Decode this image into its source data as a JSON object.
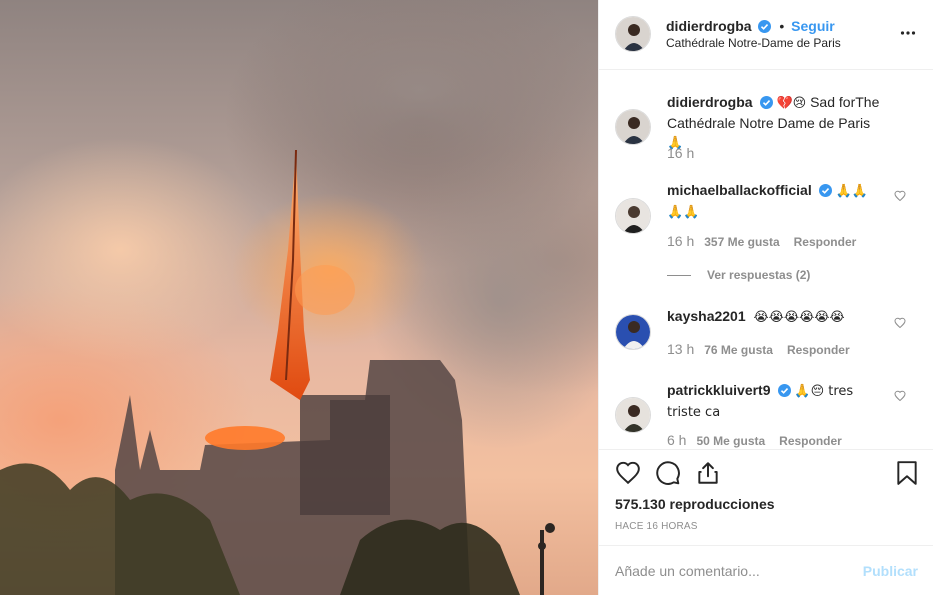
{
  "post": {
    "author": "didierdrogba",
    "follow_label": "Seguir",
    "location": "Cathédrale Notre-Dame de Paris",
    "caption_suffix": "Sad forThe Cathédrale Notre Dame de Paris",
    "caption_emoji": "💔😢",
    "caption_end_emoji": "🙏",
    "caption_time": "16 h",
    "views": "575.130 reproducciones",
    "posted_ago": "HACE 16 HORAS"
  },
  "comments": [
    {
      "user": "michaelballackofficial",
      "text": "🙏🙏 🙏🙏",
      "time": "16 h",
      "likes": "357 Me gusta",
      "reply": "Responder",
      "view_replies": "Ver respuestas (2)",
      "verified": true
    },
    {
      "user": "kaysha2201",
      "text": "😭😭😭😭😭😭",
      "time": "13 h",
      "likes": "76 Me gusta",
      "reply": "Responder",
      "verified": false
    },
    {
      "user": "patrickkluivert9",
      "text": "🙏😔 tres triste ca",
      "time": "6 h",
      "likes": "50 Me gusta",
      "reply": "Responder",
      "verified": true
    }
  ],
  "composer": {
    "placeholder": "Añade un comentario...",
    "publish_label": "Publicar"
  },
  "colors": {
    "link_blue": "#3897f0",
    "publish_disabled": "#b2dffc",
    "muted": "#8e8e8e",
    "verified": "#3897f0"
  },
  "icons": [
    "verified-badge-icon",
    "more-options-icon",
    "heart-icon",
    "comment-icon",
    "share-icon",
    "bookmark-icon"
  ]
}
